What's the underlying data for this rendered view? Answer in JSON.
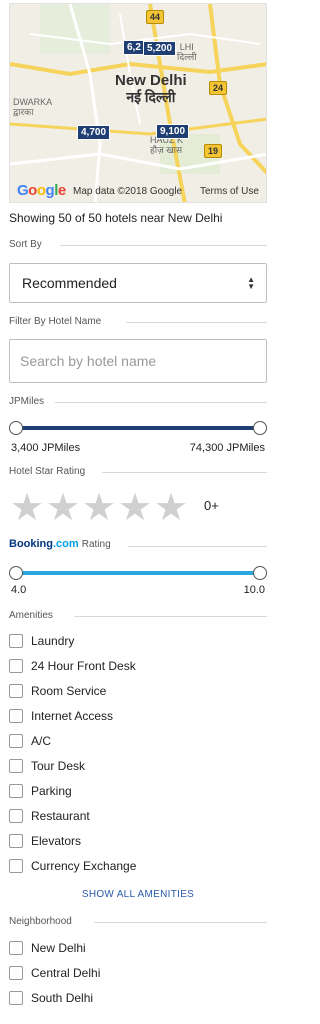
{
  "map": {
    "city_name_en": "New Delhi",
    "city_name_hi": "नई दिल्ली",
    "labels": {
      "dwarka_en": "DWARKA",
      "dwarka_hi": "द्वारका",
      "hauz_en": "HAUZ K",
      "hauz_hi": "हौज़ खास",
      "delhi_en": "LHI",
      "delhi_hi": "दिल्ली"
    },
    "pins": [
      "6,2",
      "5,200",
      "4,700",
      "9,100"
    ],
    "road_shields": [
      "44",
      "24",
      "19"
    ],
    "google_logo": "Google",
    "map_data": "Map data ©2018 Google",
    "terms": "Terms of Use",
    "colors": {
      "pin": "#1f3f74",
      "road": "#f3c433"
    }
  },
  "summary": "Showing 50 of 50 hotels near New Delhi",
  "sort": {
    "label": "Sort By",
    "value": "Recommended"
  },
  "name_filter": {
    "label": "Filter By Hotel Name",
    "placeholder": "Search by hotel name"
  },
  "jpmiles": {
    "label": "JPMiles",
    "min": "3,400 JPMiles",
    "max": "74,300 JPMiles",
    "color": "#1f3f74"
  },
  "star_rating": {
    "label": "Hotel Star Rating",
    "count": "0+",
    "stars": 5
  },
  "booking_rating": {
    "brand_1": "Booking",
    "brand_2": ".com",
    "label": "Rating",
    "min": "4.0",
    "max": "10.0",
    "color": "#29a6de"
  },
  "amenities": {
    "label": "Amenities",
    "items": [
      "Laundry",
      "24 Hour Front Desk",
      "Room Service",
      "Internet Access",
      "A/C",
      "Tour Desk",
      "Parking",
      "Restaurant",
      "Elevators",
      "Currency Exchange"
    ],
    "show_all": "SHOW ALL AMENITIES"
  },
  "neighborhood": {
    "label": "Neighborhood",
    "items": [
      "New Delhi",
      "Central Delhi",
      "South Delhi"
    ]
  }
}
